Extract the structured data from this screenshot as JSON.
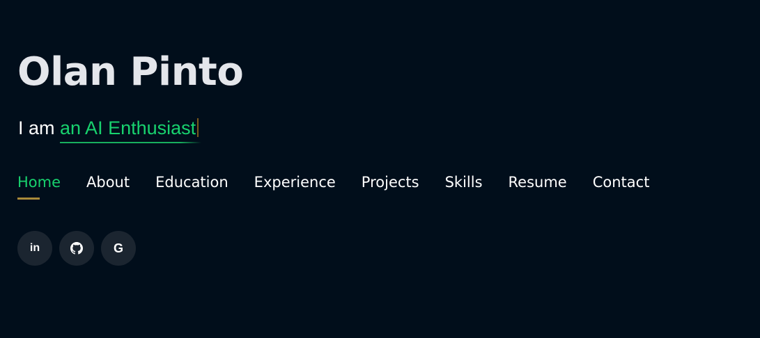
{
  "hero": {
    "name": "Olan Pinto",
    "tagline_prefix": "I am ",
    "tagline_typed": "an AI Enthusiast"
  },
  "nav": {
    "items": [
      {
        "label": "Home",
        "active": true
      },
      {
        "label": "About",
        "active": false
      },
      {
        "label": "Education",
        "active": false
      },
      {
        "label": "Experience",
        "active": false
      },
      {
        "label": "Projects",
        "active": false
      },
      {
        "label": "Skills",
        "active": false
      },
      {
        "label": "Resume",
        "active": false
      },
      {
        "label": "Contact",
        "active": false
      }
    ]
  },
  "social": {
    "linkedin_glyph": "in",
    "google_glyph": "G",
    "icons": [
      "linkedin-icon",
      "github-icon",
      "google-icon"
    ]
  },
  "colors": {
    "background": "#010e1b",
    "accent": "#18d26e",
    "underline": "#a98b3a",
    "social_bg": "#1b2530"
  }
}
